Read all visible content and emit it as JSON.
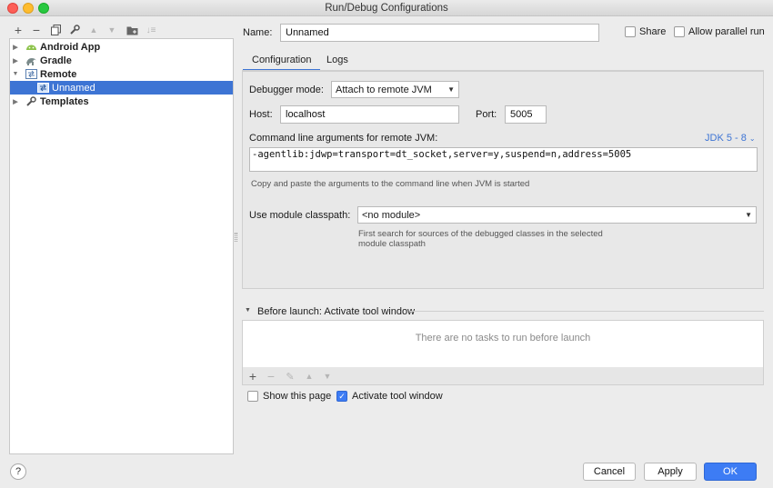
{
  "window": {
    "title": "Run/Debug Configurations"
  },
  "toolbar": {
    "icons": [
      "plus-icon",
      "minus-icon",
      "copy-icon",
      "wrench-icon",
      "move-up-icon",
      "move-down-icon",
      "folder-icon",
      "sort-icon"
    ]
  },
  "tree": {
    "items": [
      {
        "label": "Android App",
        "icon": "android-icon",
        "expanded": false
      },
      {
        "label": "Gradle",
        "icon": "gradle-icon",
        "expanded": false
      },
      {
        "label": "Remote",
        "icon": "remote-icon",
        "expanded": true
      },
      {
        "label": "Unnamed",
        "icon": "remote-config-icon",
        "selected": true
      },
      {
        "label": "Templates",
        "icon": "wrench-icon",
        "expanded": false
      }
    ]
  },
  "form": {
    "name_label": "Name:",
    "name_value": "Unnamed",
    "share_label": "Share",
    "parallel_label": "Allow parallel run",
    "tabs": [
      {
        "label": "Configuration",
        "active": true
      },
      {
        "label": "Logs",
        "active": false
      }
    ]
  },
  "config": {
    "debugger_mode_label": "Debugger mode:",
    "debugger_mode_value": "Attach to remote JVM",
    "host_label": "Host:",
    "host_value": "localhost",
    "port_label": "Port:",
    "port_value": "5005",
    "cmd_label": "Command line arguments for remote JVM:",
    "jdk_link": "JDK 5 - 8",
    "cmd_value": "-agentlib:jdwp=transport=dt_socket,server=y,suspend=n,address=5005",
    "cmd_hint": "Copy and paste the arguments to the command line when JVM is started",
    "module_label": "Use module classpath:",
    "module_value": "<no module>",
    "module_hint_1": "First search for sources of the debugged classes in the selected",
    "module_hint_2": "module classpath"
  },
  "before_launch": {
    "header": "Before launch: Activate tool window",
    "empty_text": "There are no tasks to run before launch",
    "show_page_label": "Show this page",
    "show_page_checked": false,
    "activate_label": "Activate tool window",
    "activate_checked": true
  },
  "buttons": {
    "help": "?",
    "cancel": "Cancel",
    "apply": "Apply",
    "ok": "OK"
  },
  "colors": {
    "accent": "#3d74d4",
    "primary_button": "#3d7cf4",
    "link": "#3d74d4"
  }
}
